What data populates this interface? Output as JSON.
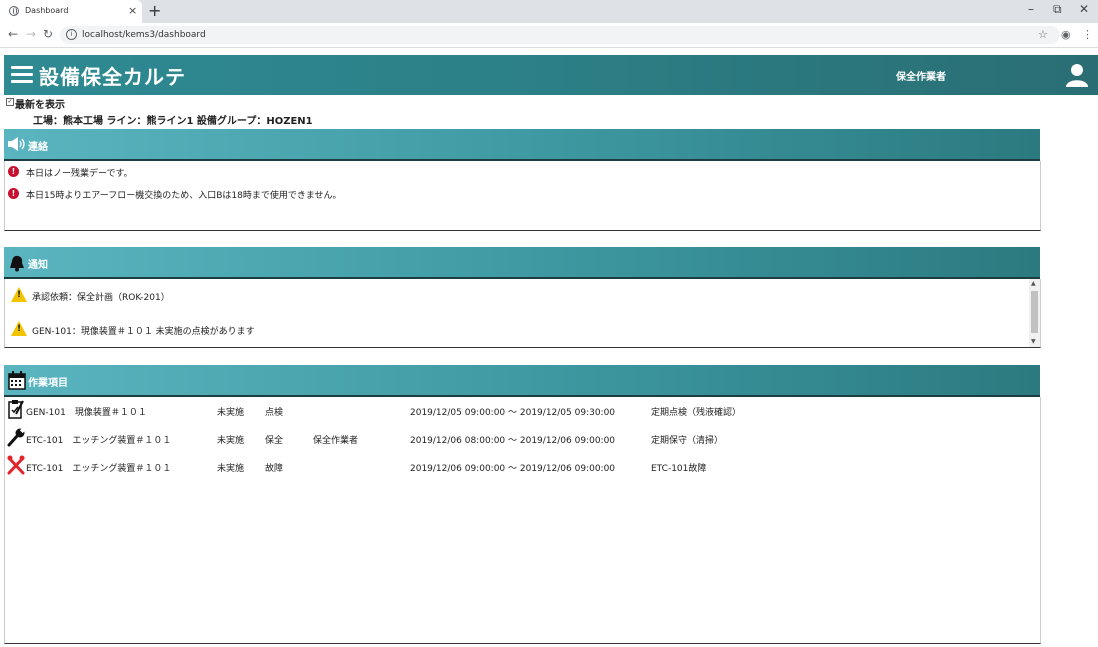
{
  "browser": {
    "tab_title": "Dashboard",
    "tab_close": "×",
    "new_tab": "+",
    "url": "localhost/kems3/dashboard",
    "window_controls": [
      "–",
      "⧉",
      "✕"
    ]
  },
  "header": {
    "title": "設備保全カルテ",
    "role": "保全作業者"
  },
  "filters": {
    "show_latest_label": "最新を表示",
    "show_latest_checked": true,
    "context": "工場：熊本工場 ライン：熊ライン1 設備グループ：HOZEN1"
  },
  "contact": {
    "title": "連絡",
    "icon": "speaker-icon",
    "messages": [
      {
        "icon": "exclamation-icon",
        "text": "本日はノー残業デーです。"
      },
      {
        "icon": "exclamation-icon",
        "text": "本日15時よりエアーフロー機交換のため、入口Bは18時まで使用できません。"
      }
    ]
  },
  "notice": {
    "title": "通知",
    "icon": "bell-icon",
    "items": [
      {
        "icon": "warning-icon",
        "text": "承認依頼：保全計画（ROK-201）"
      },
      {
        "icon": "warning-icon",
        "text": "GEN-101：現像装置＃１０１ 未実施の点検があります"
      }
    ]
  },
  "tasks": {
    "title": "作業項目",
    "icon": "calendar-icon",
    "rows": [
      {
        "icon": "checklist-icon",
        "equipment": "GEN-101　現像装置＃１０１",
        "status": "未実施",
        "type": "点検",
        "assignee": "",
        "period": "2019/12/05 09:00:00 ～ 2019/12/05 09:30:00",
        "name": "定期点検（残液確認）"
      },
      {
        "icon": "wrench-icon",
        "equipment": "ETC-101　エッチング装置＃１０１",
        "status": "未実施",
        "type": "保全",
        "assignee": "保全作業者",
        "period": "2019/12/06 08:00:00 ～ 2019/12/06 09:00:00",
        "name": "定期保守（清掃）"
      },
      {
        "icon": "broken-tools-icon",
        "equipment": "ETC-101　エッチング装置＃１０１",
        "status": "未実施",
        "type": "故障",
        "assignee": "",
        "period": "2019/12/06 09:00:00 ～ 2019/12/06 09:00:00",
        "name": "ETC-101故障"
      }
    ]
  },
  "colors": {
    "header_bg": "#2c7f86",
    "panel_light": "#5ab5c0",
    "error": "#c8102e",
    "warning": "#f2c400",
    "tool_red": "#e0252b"
  }
}
